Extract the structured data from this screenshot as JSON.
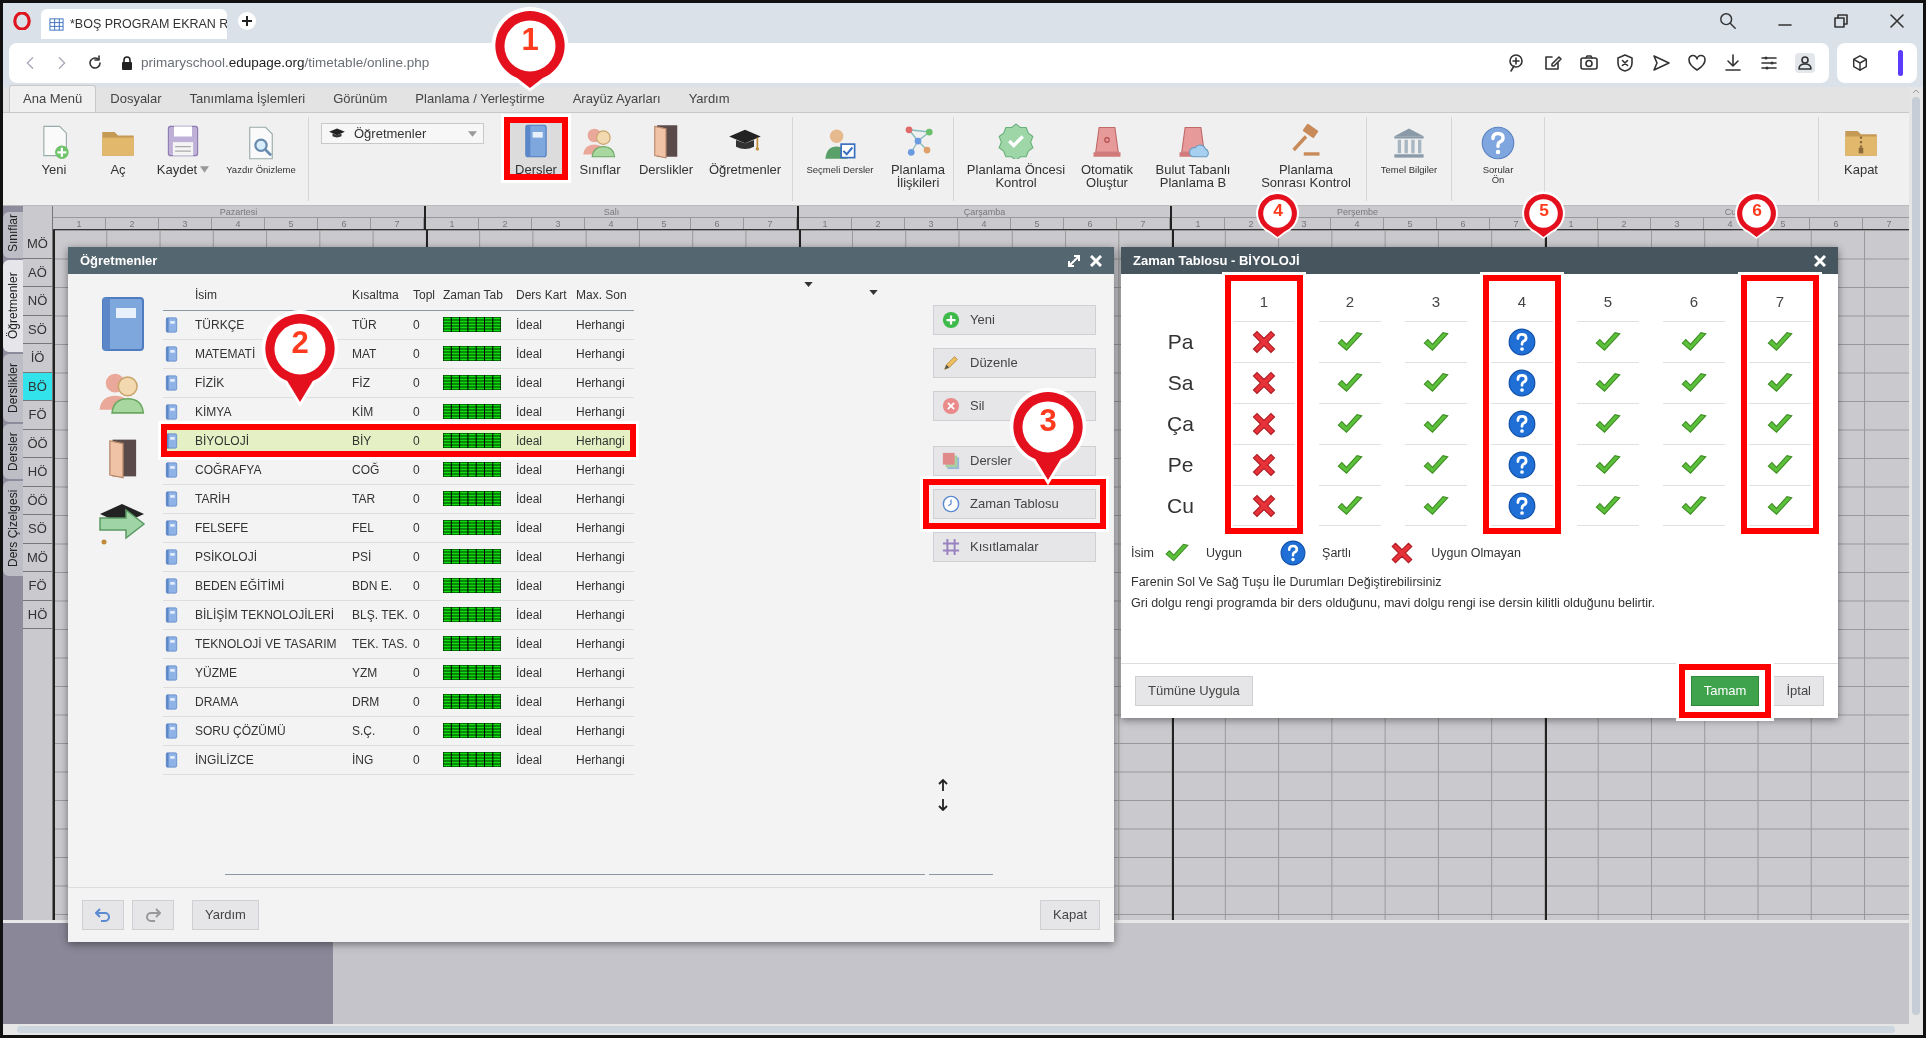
{
  "browser": {
    "tab_title": "*BOŞ PROGRAM EKRAN R",
    "url": {
      "subdomain": "primaryschool.",
      "domain": "edupage.org",
      "path": "/timetable/online.php"
    }
  },
  "menu": [
    {
      "label": "Ana Menü",
      "selected": true
    },
    {
      "label": "Dosyalar",
      "selected": false
    },
    {
      "label": "Tanımlama İşlemleri",
      "selected": false
    },
    {
      "label": "Görünüm",
      "selected": false
    },
    {
      "label": "Planlama / Yerleştirme",
      "selected": false
    },
    {
      "label": "Arayüz Ayarları",
      "selected": false
    },
    {
      "label": "Yardım",
      "selected": false
    }
  ],
  "toolbar": [
    [
      {
        "label": "Yeni",
        "kind": "large",
        "selected": false
      },
      {
        "label": "Aç",
        "kind": "large",
        "selected": false
      },
      {
        "label": "Kaydet",
        "kind": "menu",
        "selected": false
      },
      {
        "label": "Yazdır Önizleme",
        "kind": "compact",
        "selected": false
      }
    ],
    [
      {
        "label": "Öğretmenler",
        "kind": "dropdown",
        "selected": false
      },
      {
        "label": "Dersler",
        "kind": "large",
        "selected": true
      },
      {
        "label": "Sınıflar",
        "kind": "large",
        "selected": false
      },
      {
        "label": "Derslikler",
        "kind": "large",
        "selected": false
      },
      {
        "label": "Öğretmenler",
        "kind": "large",
        "selected": false
      }
    ],
    [
      {
        "label": "Seçmeli Dersler",
        "kind": "compact",
        "selected": false
      },
      {
        "label": "Planlama\nİlişkileri",
        "kind": "large",
        "selected": false
      }
    ],
    [
      {
        "label": "Planlama Öncesi\nKontrol",
        "kind": "large",
        "selected": false
      },
      {
        "label": "Otomatik\nOluştur",
        "kind": "large",
        "selected": false
      },
      {
        "label": "Bulut Tabanlı\nPlanlama B",
        "kind": "large",
        "selected": false
      },
      {
        "label": "Planlama\nSonrası Kontrol",
        "kind": "large",
        "selected": false
      }
    ],
    [
      {
        "label": "Temel Bilgiler",
        "kind": "compact",
        "selected": false
      }
    ],
    [
      {
        "label": "Sorular\nÖn",
        "kind": "compact",
        "selected": false
      }
    ],
    [
      {
        "label": "Kapat",
        "kind": "large",
        "selected": false
      }
    ]
  ],
  "timetable": {
    "side_tabs": [
      {
        "label": "Sınıflar",
        "selected": false
      },
      {
        "label": "Öğretmenler",
        "selected": true
      },
      {
        "label": "Derslikler",
        "selected": false
      },
      {
        "label": "Dersler",
        "selected": false
      },
      {
        "label": "Ders Çizelgesi",
        "selected": false
      }
    ],
    "days": [
      {
        "name": "Pazartesi",
        "periods": [
          "1",
          "2",
          "3",
          "4",
          "5",
          "6",
          "7"
        ]
      },
      {
        "name": "Salı",
        "periods": [
          "1",
          "2",
          "3",
          "4",
          "5",
          "6",
          "7"
        ]
      },
      {
        "name": "Çarşamba",
        "periods": [
          "1",
          "2",
          "3",
          "4",
          "5",
          "6",
          "7"
        ]
      },
      {
        "name": "Perşembe",
        "periods": [
          "1",
          "2",
          "3",
          "4",
          "5",
          "6",
          "7"
        ]
      },
      {
        "name": "Cu",
        "periods": [
          "1",
          "2",
          "3",
          "4",
          "5",
          "6",
          "7"
        ]
      }
    ],
    "rows": [
      {
        "label": "MÖ",
        "selected": false
      },
      {
        "label": "AÖ",
        "selected": false
      },
      {
        "label": "NÖ",
        "selected": false
      },
      {
        "label": "SÖ",
        "selected": false
      },
      {
        "label": "İÖ",
        "selected": false
      },
      {
        "label": "BÖ",
        "selected": true
      },
      {
        "label": "FÖ",
        "selected": false
      },
      {
        "label": "ÖÖ",
        "selected": false
      },
      {
        "label": "HÖ",
        "selected": false
      },
      {
        "label": "ÖÖ",
        "selected": false
      },
      {
        "label": "SÖ",
        "selected": false
      },
      {
        "label": "MÖ",
        "selected": false
      },
      {
        "label": "FÖ",
        "selected": false
      },
      {
        "label": "HÖ",
        "selected": false
      }
    ]
  },
  "subjects_dialog": {
    "title": "Öğretmenler",
    "columns": [
      "İsim",
      "Kısaltma",
      "Topl",
      "Zaman Tab",
      "Ders Kart",
      "Max. Son"
    ],
    "rows": [
      {
        "name": "TÜRKÇE",
        "short": "TÜR",
        "total": "0",
        "card": "İdeal",
        "max": "Herhangi",
        "selected": false
      },
      {
        "name": "MATEMATİ",
        "short": "MAT",
        "total": "0",
        "card": "İdeal",
        "max": "Herhangi",
        "selected": false
      },
      {
        "name": "FİZİK",
        "short": "FİZ",
        "total": "0",
        "card": "İdeal",
        "max": "Herhangi",
        "selected": false
      },
      {
        "name": "KİMYA",
        "short": "KİM",
        "total": "0",
        "card": "İdeal",
        "max": "Herhangi",
        "selected": false
      },
      {
        "name": "BİYOLOJİ",
        "short": "BİY",
        "total": "0",
        "card": "İdeal",
        "max": "Herhangi",
        "selected": true
      },
      {
        "name": "COĞRAFYA",
        "short": "COĞ",
        "total": "0",
        "card": "İdeal",
        "max": "Herhangi",
        "selected": false
      },
      {
        "name": "TARİH",
        "short": "TAR",
        "total": "0",
        "card": "İdeal",
        "max": "Herhangi",
        "selected": false
      },
      {
        "name": "FELSEFE",
        "short": "FEL",
        "total": "0",
        "card": "İdeal",
        "max": "Herhangi",
        "selected": false
      },
      {
        "name": "PSİKOLOJİ",
        "short": "PSİ",
        "total": "0",
        "card": "İdeal",
        "max": "Herhangi",
        "selected": false
      },
      {
        "name": "BEDEN EĞİTİMİ",
        "short": "BDN E.",
        "total": "0",
        "card": "İdeal",
        "max": "Herhangi",
        "selected": false
      },
      {
        "name": "BİLİŞİM TEKNOLOJİLERİ",
        "short": "BLŞ. TEK.",
        "total": "0",
        "card": "İdeal",
        "max": "Herhangi",
        "selected": false
      },
      {
        "name": "TEKNOLOJİ VE TASARIM",
        "short": "TEK. TAS.",
        "total": "0",
        "card": "İdeal",
        "max": "Herhangi",
        "selected": false
      },
      {
        "name": "YÜZME",
        "short": "YZM",
        "total": "0",
        "card": "İdeal",
        "max": "Herhangi",
        "selected": false
      },
      {
        "name": "DRAMA",
        "short": "DRM",
        "total": "0",
        "card": "İdeal",
        "max": "Herhangi",
        "selected": false
      },
      {
        "name": "SORU ÇÖZÜMÜ",
        "short": "S.Ç.",
        "total": "0",
        "card": "İdeal",
        "max": "Herhangi",
        "selected": false
      },
      {
        "name": "İNGİLİZCE",
        "short": "İNG",
        "total": "0",
        "card": "İdeal",
        "max": "Herhangi",
        "selected": false
      }
    ],
    "actions": [
      "Yeni",
      "Düzenle",
      "Sil",
      "Dersler",
      "Zaman Tablosu",
      "Kısıtlamalar"
    ],
    "help": "Yardım",
    "close": "Kapat"
  },
  "timetable_dialog": {
    "title": "Zaman Tablosu - BİYOLOJİ",
    "periods": [
      "1",
      "2",
      "3",
      "4",
      "5",
      "6",
      "7"
    ],
    "days": [
      {
        "label": "Pa",
        "cells": [
          {
            "kind": "unavailable"
          },
          {
            "kind": "available"
          },
          {
            "kind": "available"
          },
          {
            "kind": "conditional"
          },
          {
            "kind": "available"
          },
          {
            "kind": "available"
          },
          {
            "kind": "available"
          }
        ]
      },
      {
        "label": "Sa",
        "cells": [
          {
            "kind": "unavailable"
          },
          {
            "kind": "available"
          },
          {
            "kind": "available"
          },
          {
            "kind": "conditional"
          },
          {
            "kind": "available"
          },
          {
            "kind": "available"
          },
          {
            "kind": "available"
          }
        ]
      },
      {
        "label": "Ça",
        "cells": [
          {
            "kind": "unavailable"
          },
          {
            "kind": "available"
          },
          {
            "kind": "available"
          },
          {
            "kind": "conditional"
          },
          {
            "kind": "available"
          },
          {
            "kind": "available"
          },
          {
            "kind": "available"
          }
        ]
      },
      {
        "label": "Pe",
        "cells": [
          {
            "kind": "unavailable"
          },
          {
            "kind": "available"
          },
          {
            "kind": "available"
          },
          {
            "kind": "conditional"
          },
          {
            "kind": "available"
          },
          {
            "kind": "available"
          },
          {
            "kind": "available"
          }
        ]
      },
      {
        "label": "Cu",
        "cells": [
          {
            "kind": "unavailable"
          },
          {
            "kind": "available"
          },
          {
            "kind": "available"
          },
          {
            "kind": "conditional"
          },
          {
            "kind": "available"
          },
          {
            "kind": "available"
          },
          {
            "kind": "available"
          }
        ]
      }
    ],
    "legend": {
      "title": "İsim",
      "items": [
        {
          "kind": "available",
          "label": "Uygun"
        },
        {
          "kind": "conditional",
          "label": "Şartlı"
        },
        {
          "kind": "unavailable",
          "label": "Uygun Olmayan"
        }
      ]
    },
    "notes": [
      "Farenin Sol Ve Sağ Tuşu İle Durumları Değiştirebilirsiniz",
      "Gri dolgu rengi programda bir ders olduğunu, mavi dolgu rengi ise dersin kilitli olduğunu belirtir."
    ],
    "apply_all": "Tümüne Uygula",
    "ok": "Tamam",
    "cancel": "İptal"
  },
  "annotations": [
    {
      "number": "1"
    },
    {
      "number": "2"
    },
    {
      "number": "3"
    },
    {
      "number": "4"
    },
    {
      "number": "5"
    },
    {
      "number": "6"
    }
  ]
}
